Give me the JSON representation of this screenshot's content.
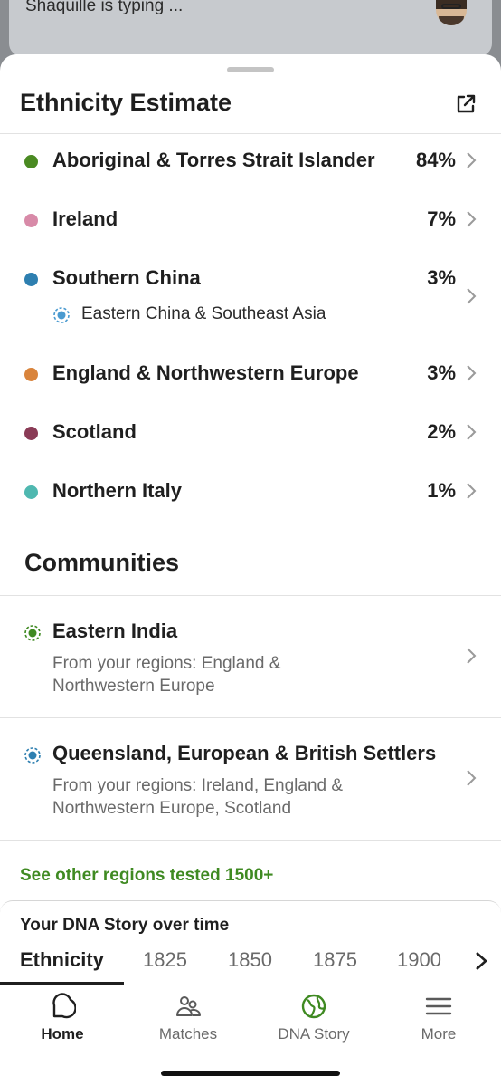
{
  "notification": {
    "text": "Shaquille is typing ..."
  },
  "header": {
    "title": "Ethnicity Estimate"
  },
  "ethnicities": [
    {
      "name": "Aboriginal & Torres Strait Islander",
      "percent": "84%",
      "color": "#4a8a22"
    },
    {
      "name": "Ireland",
      "percent": "7%",
      "color": "#d88aa8"
    },
    {
      "name": "Southern China",
      "percent": "3%",
      "color": "#2e7fb0"
    },
    {
      "name": "England & Northwestern Europe",
      "percent": "3%",
      "color": "#d9843c"
    },
    {
      "name": "Scotland",
      "percent": "2%",
      "color": "#8a3b56"
    },
    {
      "name": "Northern Italy",
      "percent": "1%",
      "color": "#4fb8b0"
    }
  ],
  "subregion": {
    "name": "Eastern China & Southeast Asia",
    "color": "#4a9ad0"
  },
  "communities": {
    "title": "Communities",
    "items": [
      {
        "name": "Eastern India",
        "desc": "From your regions: England & Northwestern Europe",
        "color": "#3f8a22"
      },
      {
        "name": "Queensland, European & British Settlers",
        "desc": "From your regions: Ireland, England & Northwestern Europe, Scotland",
        "color": "#2e7fb0"
      }
    ]
  },
  "see_other": "See other regions tested 1500+",
  "story": {
    "title": "Your DNA Story over time",
    "tabs": [
      "Ethnicity",
      "1825",
      "1850",
      "1875",
      "1900"
    ]
  },
  "nav": {
    "items": [
      {
        "label": "Home",
        "icon": "home-icon"
      },
      {
        "label": "Matches",
        "icon": "matches-icon"
      },
      {
        "label": "DNA Story",
        "icon": "dna-story-icon"
      },
      {
        "label": "More",
        "icon": "menu-icon"
      }
    ]
  },
  "colors": {
    "accent": "#3f8a22",
    "text": "#1f1f1f",
    "muted": "#6a6a6a"
  }
}
